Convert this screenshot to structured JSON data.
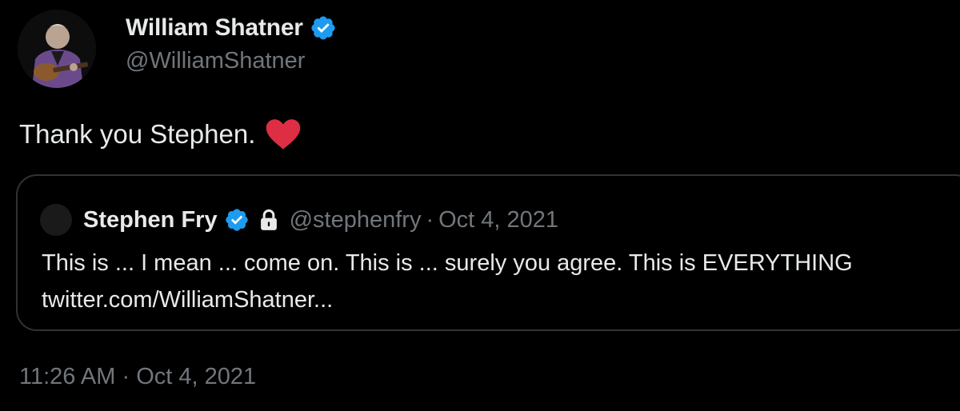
{
  "author": {
    "name": "William Shatner",
    "handle": "@WilliamShatner",
    "verified_icon": "verified-badge",
    "avatar_icon": "avatar"
  },
  "tweet": {
    "text": "Thank you Stephen.",
    "emoji": "red-heart"
  },
  "quote": {
    "name": "Stephen Fry",
    "handle": "@stephenfry",
    "separator": "·",
    "date": "Oct 4, 2021",
    "line1": "This is ... I mean ... come on. This is ... surely you agree. This is EVERYTHING",
    "line2": "twitter.com/WilliamShatner..."
  },
  "timestamp": {
    "time": "11:26 AM",
    "separator": "·",
    "date": "Oct 4, 2021"
  },
  "colors": {
    "background": "#000000",
    "primary_text": "#e7e9ea",
    "secondary_text": "#71767b",
    "verified_blue": "#1d9bf0",
    "heart_red": "#dd2e44",
    "border": "#2f3336"
  }
}
